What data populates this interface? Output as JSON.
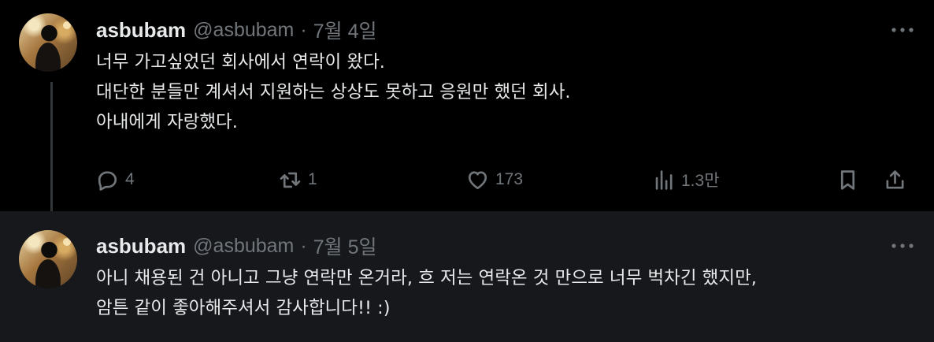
{
  "tweets": [
    {
      "display_name": "asbubam",
      "handle": "@asbubam",
      "separator": "·",
      "date": "7월 4일",
      "lines": [
        "너무 가고싶었던 회사에서 연락이 왔다.",
        "대단한 분들만 계셔서 지원하는 상상도 못하고 응원만 했던 회사.",
        "아내에게 자랑했다."
      ],
      "stats": {
        "replies": "4",
        "reposts": "1",
        "likes": "173",
        "views": "1.3만"
      }
    },
    {
      "display_name": "asbubam",
      "handle": "@asbubam",
      "separator": "·",
      "date": "7월 5일",
      "lines": [
        "아니 채용된 건 아니고 그냥 연락만 온거라, 흐 저는 연락온 것 만으로 너무 벅차긴 했지만,",
        "암튼 같이 좋아해주셔서 감사합니다!! :)"
      ]
    }
  ],
  "icons": {
    "more": "more-horizontal-icon",
    "reply": "reply-icon",
    "repost": "repost-icon",
    "like": "heart-icon",
    "views": "analytics-icon",
    "bookmark": "bookmark-icon",
    "share": "share-icon"
  },
  "colors": {
    "background": "#000000",
    "reply_background": "#16181c",
    "text": "#e7e9ea",
    "muted": "#71767b",
    "thread_line": "#333639"
  }
}
